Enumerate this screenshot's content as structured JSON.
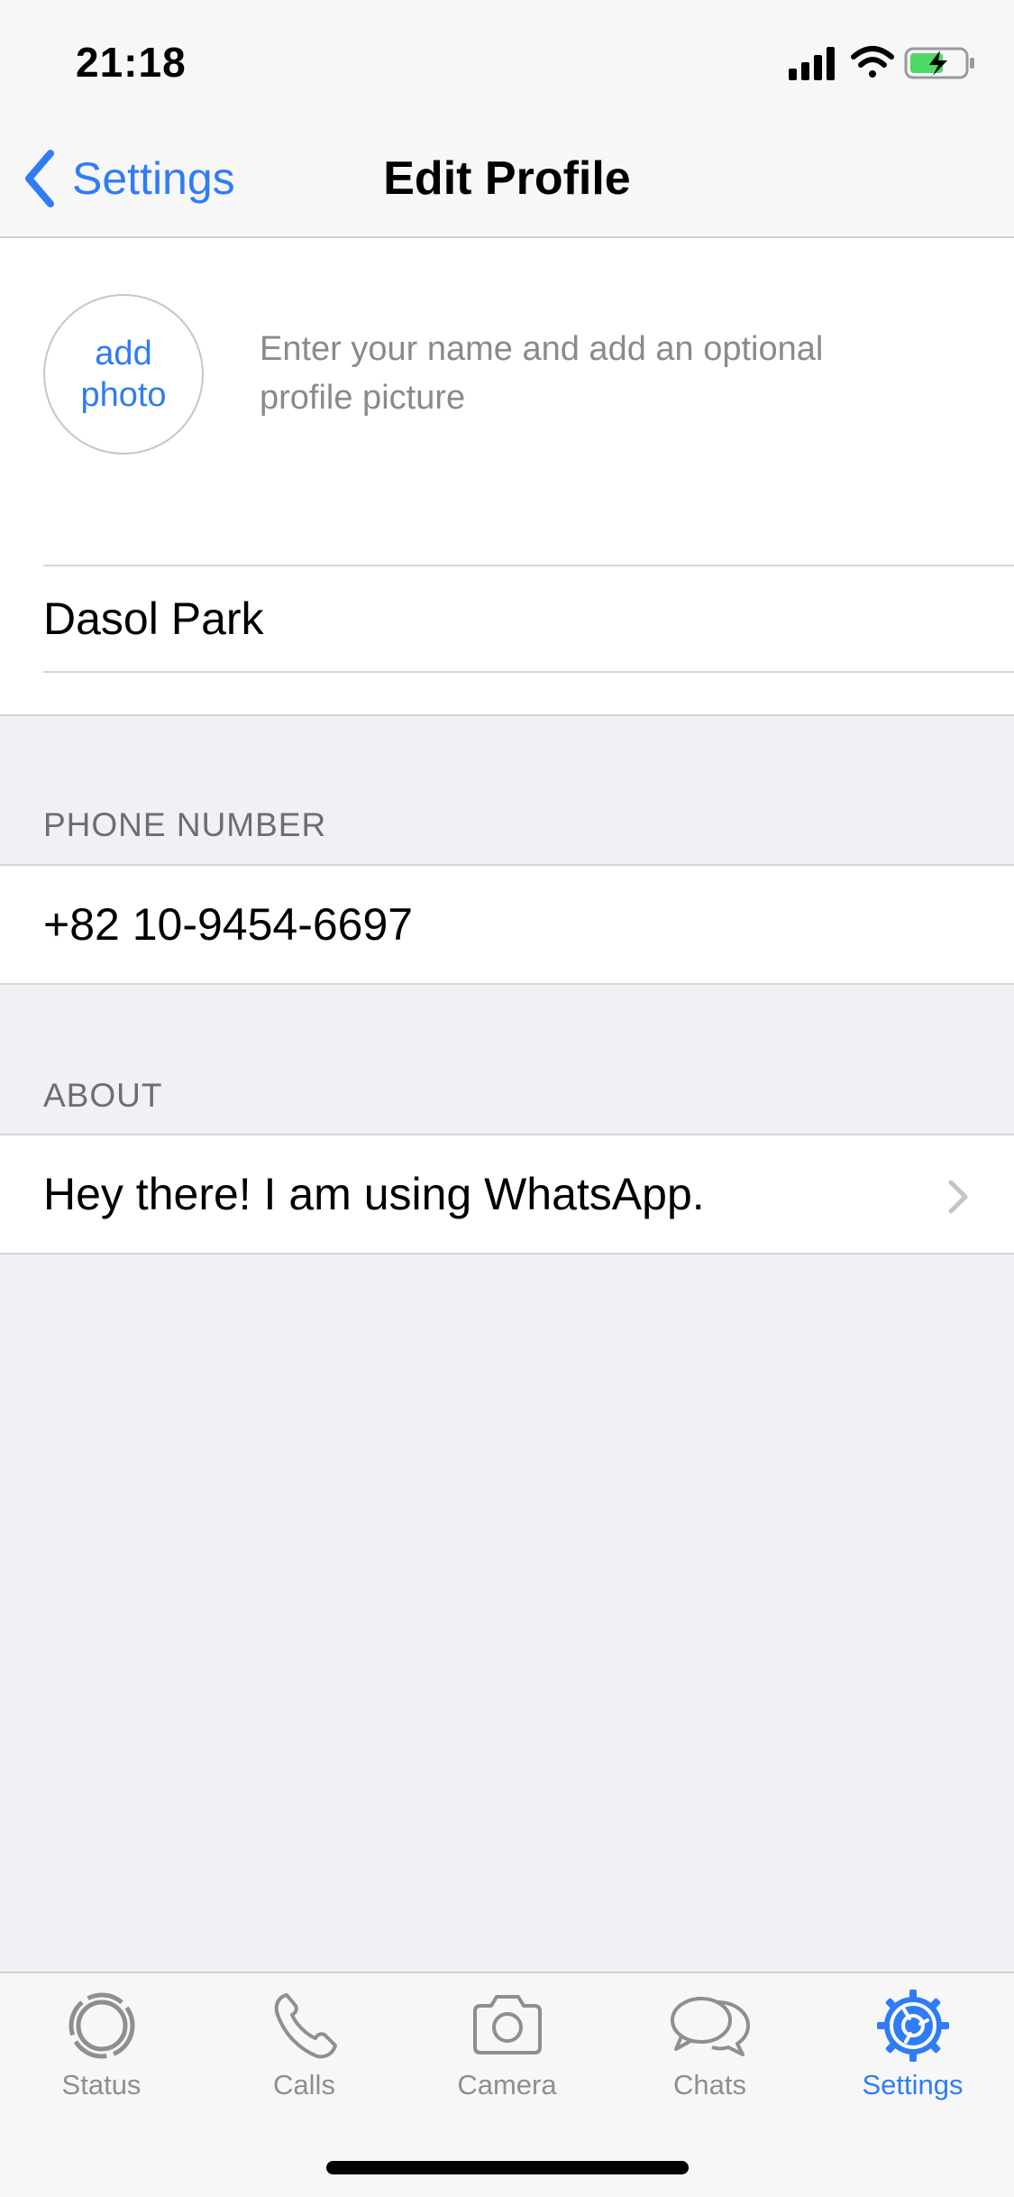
{
  "status_bar": {
    "time": "21:18",
    "icons": [
      "signal-icon",
      "wifi-icon",
      "battery-charging-icon"
    ]
  },
  "nav": {
    "back_label": "Settings",
    "title": "Edit Profile"
  },
  "profile": {
    "add_photo_line1": "add",
    "add_photo_line2": "photo",
    "hint": "Enter your name and add an optional profile picture",
    "name_value": "Dasol Park"
  },
  "phone": {
    "header": "PHONE NUMBER",
    "value": "+82 10-9454-6697"
  },
  "about": {
    "header": "ABOUT",
    "value": "Hey there! I am using WhatsApp."
  },
  "tab_bar": {
    "tabs": [
      {
        "label": "Status",
        "icon": "status-icon",
        "active": false
      },
      {
        "label": "Calls",
        "icon": "phone-icon",
        "active": false
      },
      {
        "label": "Camera",
        "icon": "camera-icon",
        "active": false
      },
      {
        "label": "Chats",
        "icon": "chat-bubbles-icon",
        "active": false
      },
      {
        "label": "Settings",
        "icon": "gear-icon",
        "active": true
      }
    ]
  },
  "colors": {
    "accent": "#2f7cf6",
    "inactive": "#8e8e93",
    "background": "#f0f0f5",
    "battery_green": "#4cd964"
  }
}
